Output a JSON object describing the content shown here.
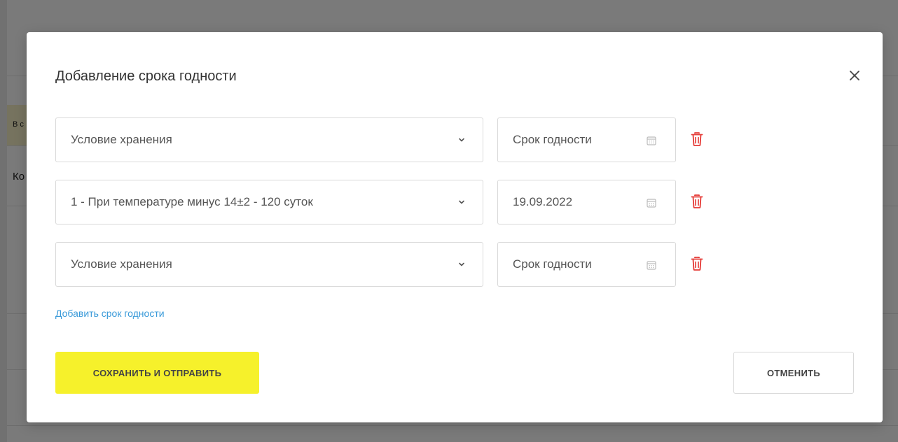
{
  "background": {
    "fragment_1": "В с",
    "fragment_2": "Ко"
  },
  "modal": {
    "title": "Добавление срока годности",
    "close_icon": "close-icon",
    "rows": [
      {
        "condition": "Условие хранения",
        "date": "Срок годности"
      },
      {
        "condition": "1 - При температуре минус 14±2 - 120 суток",
        "date": "19.09.2022"
      },
      {
        "condition": "Условие хранения",
        "date": "Срок годности"
      }
    ],
    "add_link": "Добавить срок годности",
    "save_label": "СОХРАНИТЬ И ОТПРАВИТЬ",
    "cancel_label": "ОТМЕНИТЬ"
  },
  "colors": {
    "accent_yellow": "#f6f12b",
    "link_blue": "#3a9ad9",
    "delete_red": "#e53935"
  }
}
